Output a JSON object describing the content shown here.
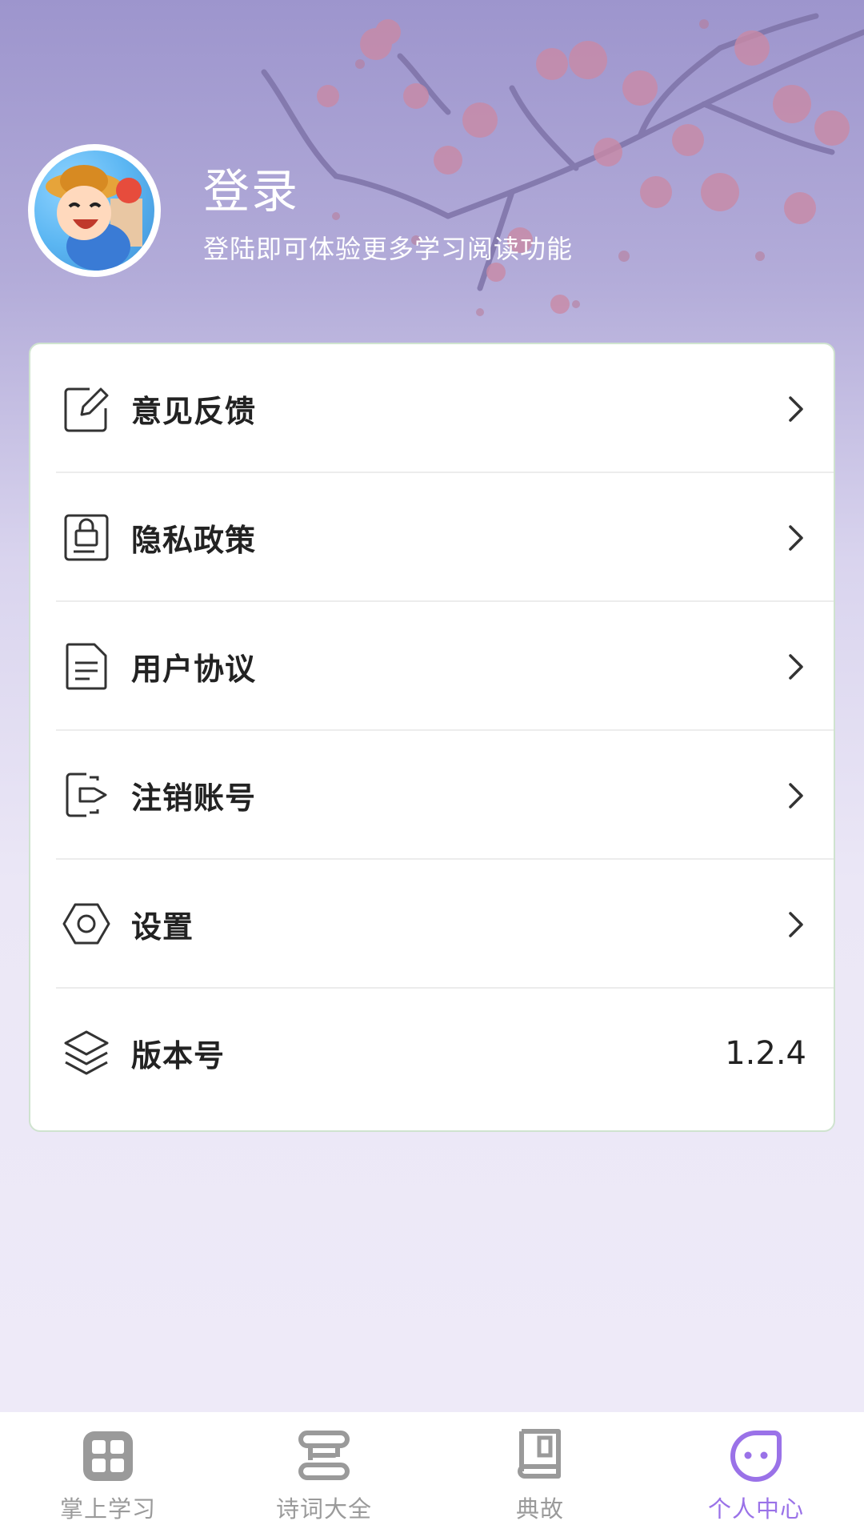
{
  "header": {
    "title": "登录",
    "subtitle": "登陆即可体验更多学习阅读功能"
  },
  "menu": {
    "items": [
      {
        "label": "意见反馈",
        "icon": "edit-icon"
      },
      {
        "label": "隐私政策",
        "icon": "lock-document-icon"
      },
      {
        "label": "用户协议",
        "icon": "document-icon"
      },
      {
        "label": "注销账号",
        "icon": "logout-icon"
      },
      {
        "label": "设置",
        "icon": "hexagon-settings-icon"
      },
      {
        "label": "版本号",
        "icon": "layers-icon",
        "value": "1.2.4"
      }
    ]
  },
  "tabbar": {
    "tabs": [
      {
        "label": "掌上学习",
        "icon": "grid-icon"
      },
      {
        "label": "诗词大全",
        "icon": "scroll-icon"
      },
      {
        "label": "典故",
        "icon": "book-icon"
      },
      {
        "label": "个人中心",
        "icon": "smiley-face-icon",
        "active": true
      }
    ]
  },
  "colors": {
    "accent": "#9a72e8",
    "background_top": "#9d95cd",
    "background_bottom": "#eeeaf8",
    "card_border": "#cfe3cf",
    "blossom": "#c98aa6",
    "branch": "#7e73a8"
  }
}
